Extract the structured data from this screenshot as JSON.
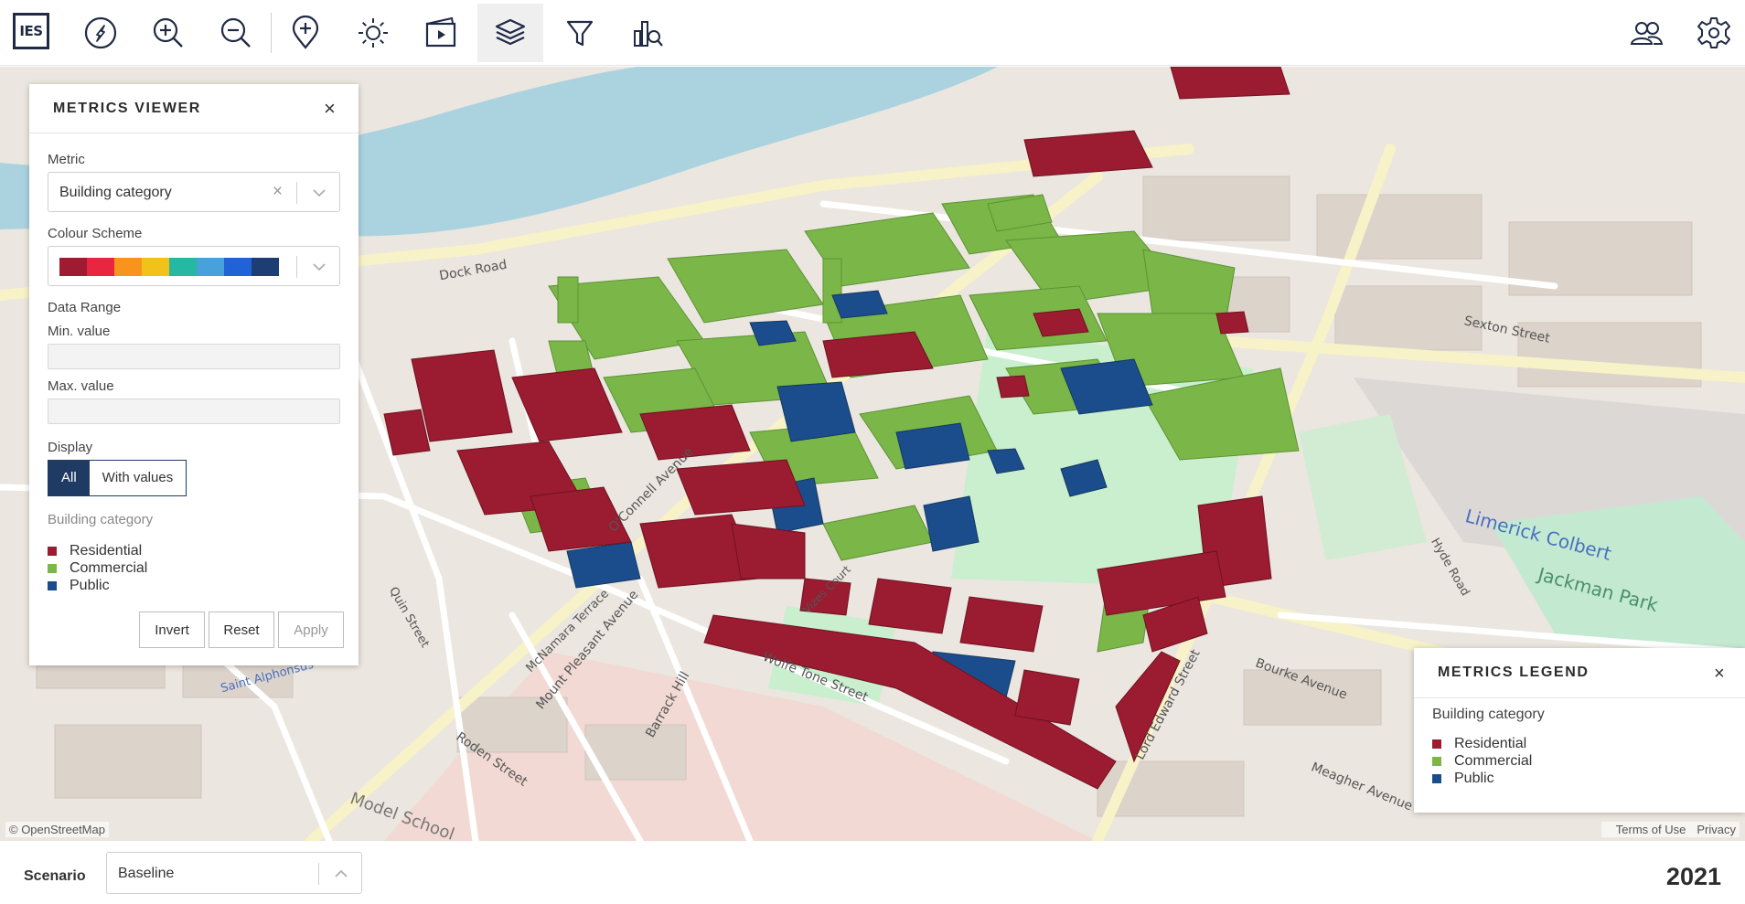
{
  "app": {
    "logo_text": "IES"
  },
  "toolbar": {
    "tools": [
      {
        "name": "compass-icon"
      },
      {
        "name": "zoom-in-icon"
      },
      {
        "name": "zoom-out-icon"
      },
      {
        "name": "add-location-icon"
      },
      {
        "name": "sun-icon"
      },
      {
        "name": "media-player-icon"
      },
      {
        "name": "layers-icon",
        "active": true
      },
      {
        "name": "filter-icon"
      },
      {
        "name": "analytics-icon"
      }
    ],
    "right_tools": [
      {
        "name": "users-icon"
      },
      {
        "name": "settings-icon"
      }
    ]
  },
  "metrics_viewer": {
    "title": "METRICS VIEWER",
    "close": "×",
    "metric_label": "Metric",
    "metric_value": "Building category",
    "metric_clear": "×",
    "colour_scheme_label": "Colour Scheme",
    "colour_scheme": [
      "#9e1b32",
      "#e8263f",
      "#f7941d",
      "#f2c21b",
      "#27b8a2",
      "#48a1dc",
      "#1f63d6",
      "#1c3e75"
    ],
    "data_range_label": "Data Range",
    "min_label": "Min. value",
    "min_value": "",
    "max_label": "Max. value",
    "max_value": "",
    "display_label": "Display",
    "display_options": [
      "All",
      "With values"
    ],
    "display_selected": "All",
    "legend_title": "Building category",
    "legend": [
      {
        "label": "Residential",
        "color": "#9b1b30"
      },
      {
        "label": "Commercial",
        "color": "#7ab648"
      },
      {
        "label": "Public",
        "color": "#1b4d8c"
      }
    ],
    "buttons": {
      "invert": "Invert",
      "reset": "Reset",
      "apply": "Apply"
    }
  },
  "metrics_legend": {
    "title": "METRICS LEGEND",
    "close": "×",
    "subtitle": "Building category",
    "items": [
      {
        "label": "Residential",
        "color": "#9b1b30"
      },
      {
        "label": "Commercial",
        "color": "#7ab648"
      },
      {
        "label": "Public",
        "color": "#1b4d8c"
      }
    ]
  },
  "map": {
    "attribution": "© OpenStreetMap",
    "terms": "Terms of Use",
    "privacy": "Privacy",
    "street_labels": [
      {
        "text": "Dock Road"
      },
      {
        "text": "O'Connell Avenue"
      },
      {
        "text": "Wolfe Tone Street"
      },
      {
        "text": "Bourke Avenue"
      },
      {
        "text": "Lord Edward Street"
      },
      {
        "text": "Roden Street"
      },
      {
        "text": "Barrack Hill"
      },
      {
        "text": "Mount Pleasant Avenue"
      },
      {
        "text": "McNamara Terrace"
      },
      {
        "text": "Meagher Avenue"
      },
      {
        "text": "Model School"
      },
      {
        "text": "Quin Street"
      },
      {
        "text": "Jackman Park"
      },
      {
        "text": "Limerick Colbert"
      },
      {
        "text": "Sexton Street"
      },
      {
        "text": "Hyde Road"
      },
      {
        "text": "Vizes Court"
      },
      {
        "text": "Saint Alphonsus"
      }
    ]
  },
  "bottom": {
    "scenario_label": "Scenario",
    "scenario_value": "Baseline",
    "year": "2021"
  }
}
